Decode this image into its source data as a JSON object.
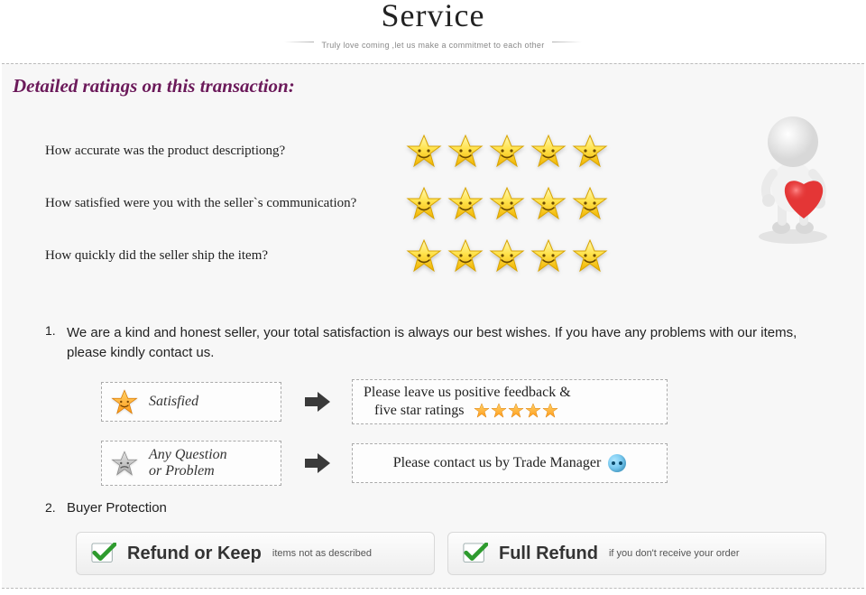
{
  "header": {
    "title": "Service",
    "subtitle": "Truly love coming ,let us make a commitmet to each other"
  },
  "detail": {
    "heading": "Detailed ratings on this transaction:",
    "questions": [
      "How accurate was the product descriptiong?",
      "How satisfied were you with the seller`s communication?",
      "How quickly did the seller ship the item?"
    ],
    "rating_value": 5
  },
  "list": {
    "item1_text": "We are a kind and honest seller, your total satisfaction is always our best wishes. If you have any problems with our items, please kindly contact us.",
    "satisfied": {
      "label": "Satisfied",
      "result_line1": "Please leave us positive feedback &",
      "result_line2": "five star ratings",
      "stars": 5
    },
    "problem": {
      "label_line1": "Any Question",
      "label_line2": "or Problem",
      "result": "Please contact us by Trade Manager"
    },
    "item2_title": "Buyer Protection",
    "refund1_main": "Refund or Keep",
    "refund1_sub": "items not as described",
    "refund2_main": "Full Refund",
    "refund2_sub": "if you don't receive your order"
  }
}
